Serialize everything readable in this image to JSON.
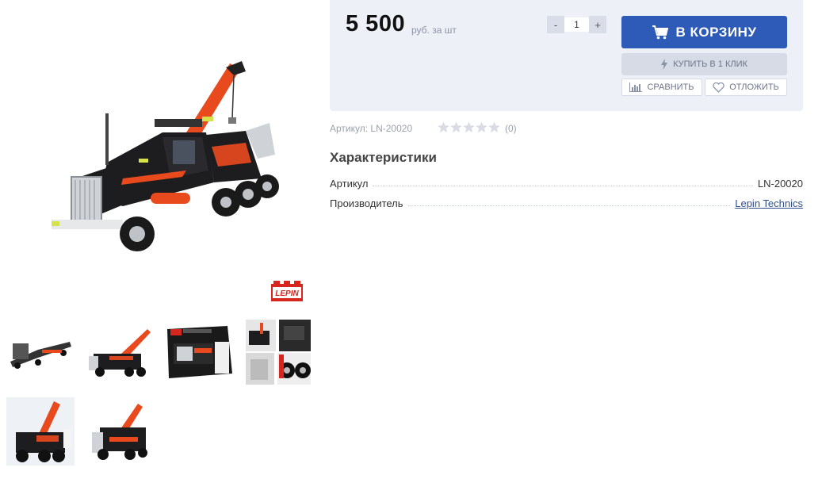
{
  "product": {
    "price": "5 500",
    "price_unit": "руб. за шт",
    "quantity": "1",
    "qty_minus": "-",
    "qty_plus": "+",
    "sku_label": "Артикул:",
    "sku_value": "LN-20020",
    "rating_count": "(0)",
    "brand_logo": "LEPIN"
  },
  "buttons": {
    "add_to_cart": "В КОРЗИНУ",
    "buy_one_click": "КУПИТЬ В 1 КЛИК",
    "compare": "СРАВНИТЬ",
    "defer": "ОТЛОЖИТЬ"
  },
  "characteristics": {
    "title": "Характеристики",
    "rows": [
      {
        "label": "Артикул",
        "value": "LN-20020"
      },
      {
        "label": "Производитель",
        "value": "Lepin Technics"
      }
    ]
  },
  "colors": {
    "accent": "#2e5ab8",
    "panel": "#eef0f7",
    "muted": "#9aa0ad"
  },
  "icons": [
    "cart-icon",
    "lightning-icon",
    "bar-chart-icon",
    "heart-icon",
    "star-icon"
  ]
}
